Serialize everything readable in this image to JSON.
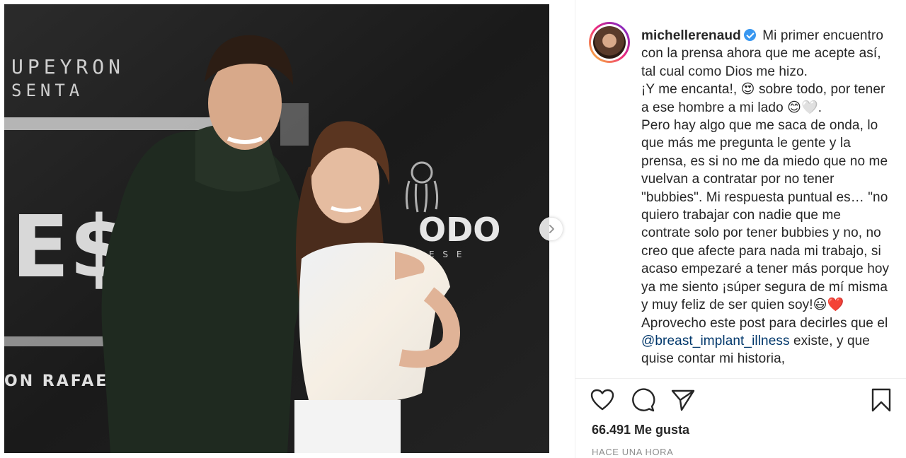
{
  "post": {
    "username": "michellerenaud",
    "verified": true,
    "caption_lines": [
      "Mi primer encuentro con la prensa ahora que me acepte así, tal cual como Dios me hizo.",
      "¡Y me encanta!, 😍 sobre todo, por tener a ese hombre a mi lado 😊🤍.",
      "Pero hay algo que me saca de onda, lo que más me pregunta le gente y la prensa, es si no me da miedo que no me vuelvan a contratar por no tener \"bubbies\". Mi respuesta puntual es… \"no quiero trabajar con nadie que me contrate solo por tener bubbies y no, no creo que afecte para nada mi trabajo, si acaso empezaré a tener más porque hoy ya me siento ¡súper segura de mí misma y muy feliz de ser quien soy!😃❤️ Aprovecho este post para decirles que el",
      "@breast_implant_illness",
      "existe, y que quise contar mi historia,"
    ],
    "likes_text": "66.491 Me gusta",
    "timestamp": "HACE UNA HORA"
  },
  "photo": {
    "backdrop_texts": [
      "UPEYRON",
      "SENTA",
      "E$T",
      "ON RAFAEL PE",
      "ODO",
      "E S E"
    ]
  },
  "colors": {
    "accent": "#3897f0",
    "mention": "#00376b",
    "text": "#262626",
    "muted": "#8e8e8e"
  },
  "icons": [
    "heart-icon",
    "comment-icon",
    "share-icon",
    "bookmark-icon",
    "chevron-right-icon",
    "verified-icon"
  ]
}
